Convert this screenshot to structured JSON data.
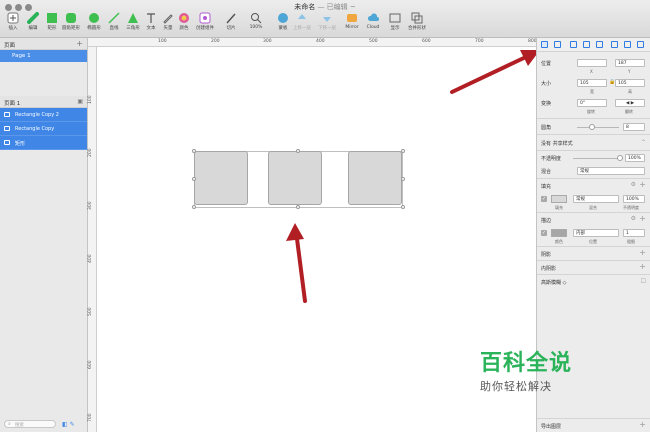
{
  "window": {
    "title": "未命名",
    "subtitle": "— 已编辑 ~"
  },
  "toolbar": {
    "insert": "插入",
    "edit": "编辑",
    "rect": "矩形",
    "rounded": "圆角矩形",
    "oval": "椭圆形",
    "line": "直线",
    "triangle": "三角形",
    "text": "文本",
    "vector": "矢量",
    "color": "颜色",
    "create_symbol": "创建组件",
    "slice": "切片",
    "zoom": "100%",
    "mask": "蒙板",
    "up_one": "上移一层",
    "down_one": "下移一层",
    "mirror": "Mirror",
    "cloud": "Cloud",
    "display": "显示",
    "combine": "合并形状"
  },
  "left": {
    "pages_header": "页面",
    "page1": "Page 1",
    "layers_header": "页面 1",
    "layers": [
      "Rectangle Copy 2",
      "Rectangle Copy",
      "矩形"
    ],
    "search_placeholder": "搜索"
  },
  "rulers": {
    "h": [
      "100",
      "200",
      "300",
      "400",
      "500",
      "600",
      "700",
      "800"
    ],
    "v": [
      "100",
      "200",
      "300",
      "400",
      "500",
      "600",
      "700"
    ]
  },
  "inspector": {
    "position_label": "位置",
    "x_value": "",
    "y_value": "187",
    "x_cap": "X",
    "y_cap": "Y",
    "size_label": "大小",
    "w_value": "105",
    "h_value": "105",
    "w_cap": "宽",
    "h_cap": "高",
    "transform_label": "变换",
    "rot_value": "0°",
    "rot_cap": "旋转",
    "flip_cap": "翻转",
    "radius_label": "圆角",
    "radius_value": "8",
    "shared_style": "没有 共享样式",
    "opacity_label": "不透明度",
    "opacity_value": "100%",
    "blend_label": "混合",
    "blend_value": "常规",
    "fill_header": "填充",
    "fill_mode": "常规",
    "fill_opacity": "100%",
    "fill_cap_color": "填充",
    "fill_cap_blend": "混合",
    "fill_cap_opacity": "不透明度",
    "border_header": "描边",
    "border_pos": "内部",
    "border_width": "1",
    "border_cap_color": "颜色",
    "border_cap_pos": "位置",
    "border_cap_width": "粗细",
    "shadow_header": "阴影",
    "inner_shadow_header": "内阴影",
    "blur_header": "高斯模糊 ◇",
    "export_header": "导出图层"
  },
  "watermark": {
    "big": "百科全说",
    "small": "助你轻松解决"
  },
  "colors": {
    "selection": "#3f86e6",
    "arrow": "#b11f24",
    "watermark": "#2bb35a"
  }
}
